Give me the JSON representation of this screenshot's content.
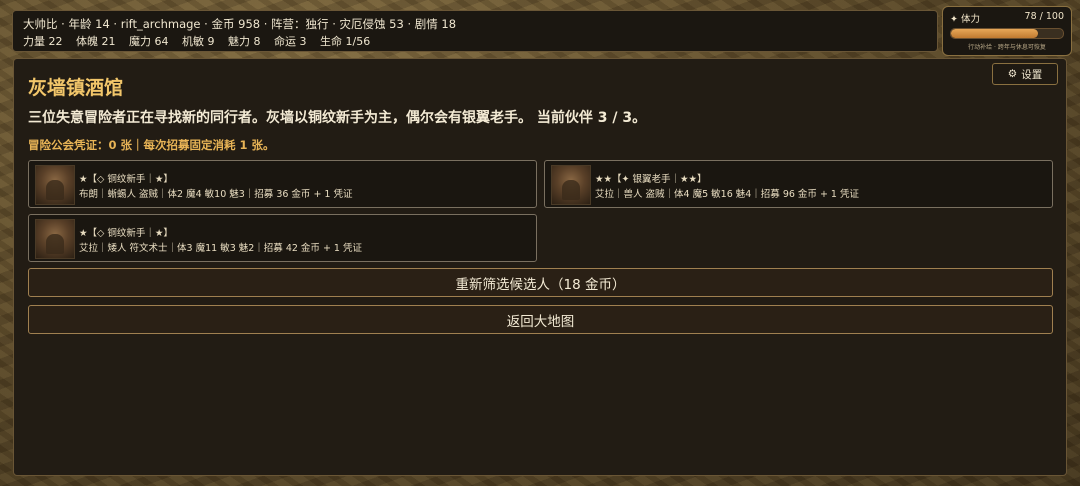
{
  "status": {
    "line1": "大帅比 · 年龄 14 · rift_archmage · 金币 958 · 阵营：独行 · 灾厄侵蚀 53 · 剧情 18",
    "stats": [
      "力量 22",
      "体魄 21",
      "魔力 64",
      "机敏 9",
      "魅力 8",
      "命运 3",
      "生命 1/56"
    ]
  },
  "stamina": {
    "label": "✦ 体力",
    "value_text": "78 / 100",
    "fraction": 0.78,
    "hint": "行动补给 · 跨年与休息可恢复"
  },
  "settings": {
    "icon": "gear-icon",
    "label": "设置"
  },
  "tavern": {
    "title": "灰墙镇酒馆",
    "description": "三位失意冒险者正在寻找新的同行者。灰墙以铜纹新手为主，偶尔会有银翼老手。 当前伙伴 3 / 3。",
    "credentials": "冒险公会凭证：0 张｜每次招募固定消耗 1 张。"
  },
  "candidates": [
    {
      "rank": "★【◇ 铜纹新手｜★】",
      "info": "布朗｜蜥蜴人 盗贼｜体2 魔4 敏10 魅3｜招募 36 金币 + 1 凭证"
    },
    {
      "rank": "★★【✦ 银翼老手｜★★】",
      "info": "艾拉｜兽人 盗贼｜体4 魔5 敏16 魅4｜招募 96 金币 + 1 凭证"
    },
    {
      "rank": "★【◇ 铜纹新手｜★】",
      "info": "艾拉｜矮人 符文术士｜体3 魔11 敏3 魅2｜招募 42 金币 + 1 凭证"
    }
  ],
  "actions": {
    "reroll": "重新筛选候选人（18 金币）",
    "back": "返回大地图"
  },
  "colors": {
    "accent": "#f2c66a",
    "credential": "#e8b456",
    "stamina": "#d89048"
  }
}
